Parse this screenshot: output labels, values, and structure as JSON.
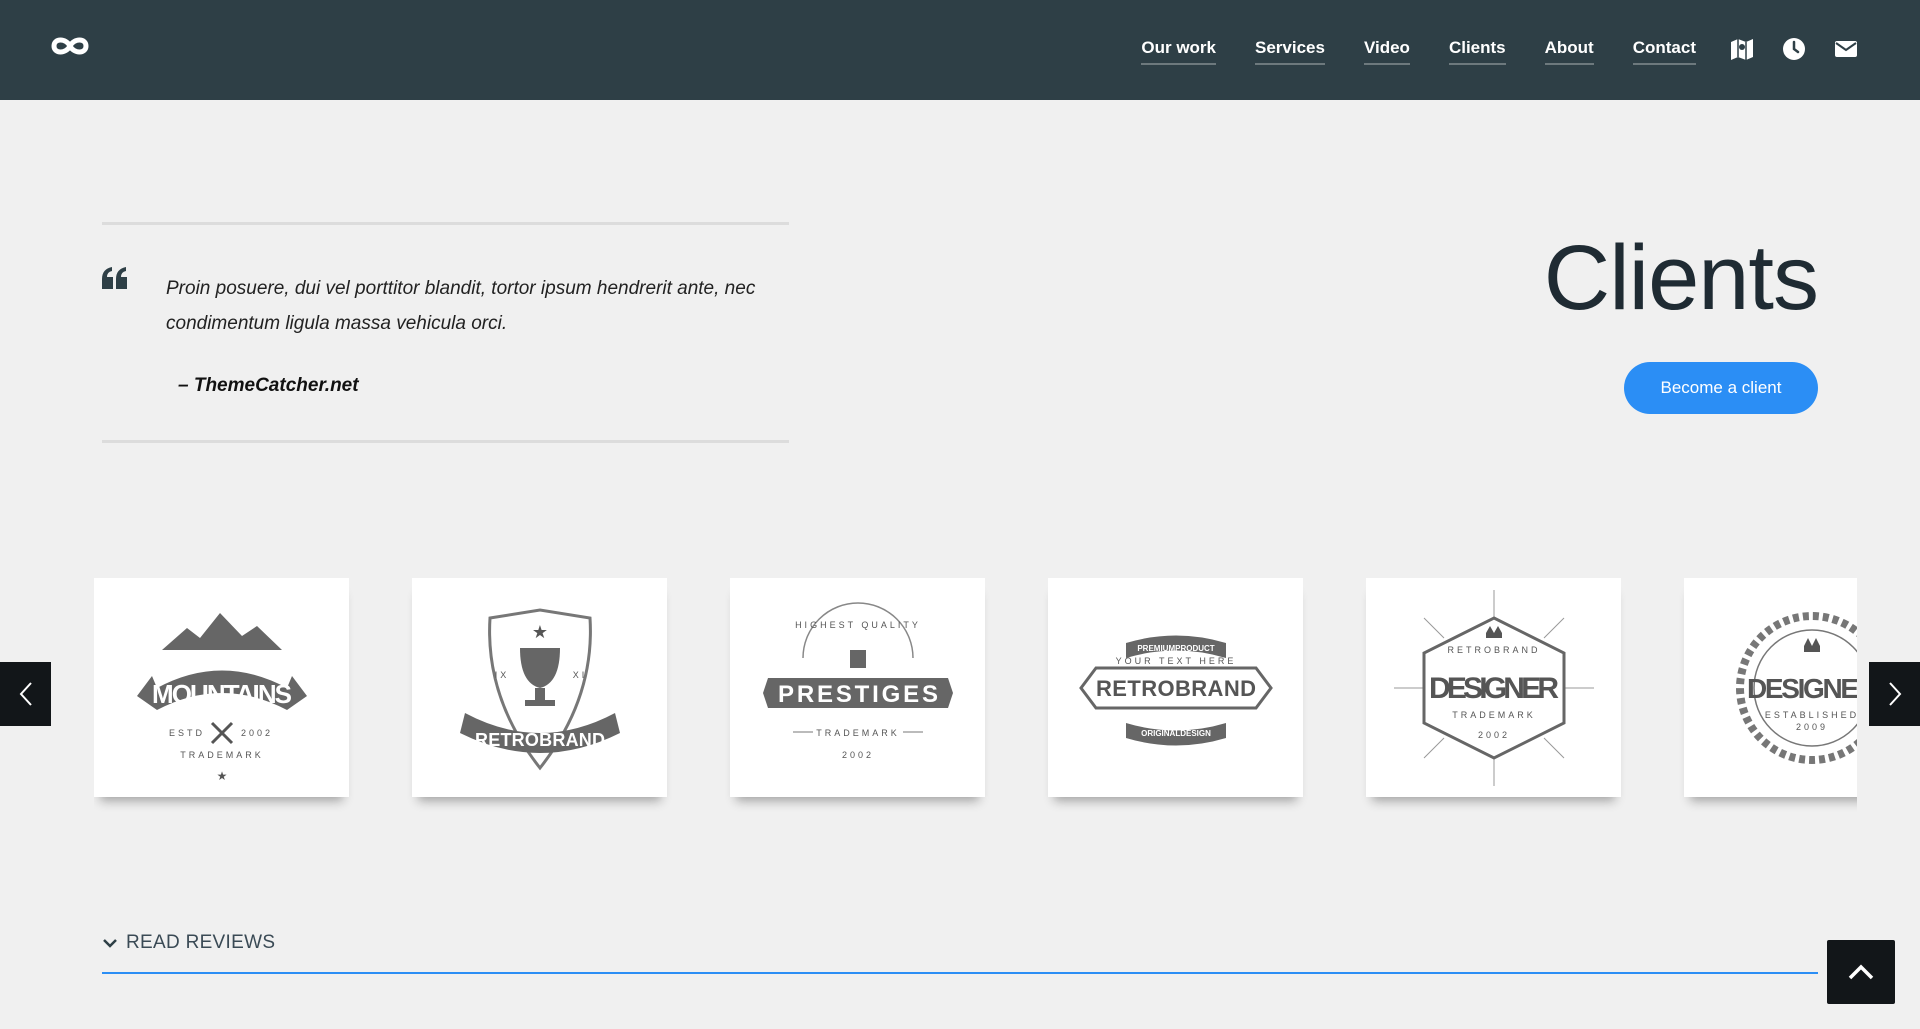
{
  "header": {
    "logo_icon": "infinity-logo-icon",
    "nav": [
      {
        "label": "Our work"
      },
      {
        "label": "Services"
      },
      {
        "label": "Video"
      },
      {
        "label": "Clients"
      },
      {
        "label": "About"
      },
      {
        "label": "Contact"
      }
    ],
    "icons": [
      "map-icon",
      "clock-icon",
      "mail-icon"
    ]
  },
  "quote": {
    "text": "Proin posuere, dui vel porttitor blandit, tortor ipsum hendrerit ante, nec condimentum ligula massa vehicula orci.",
    "author": "– ThemeCatcher.net"
  },
  "title": "Clients",
  "cta_label": "Become a client",
  "clients": [
    {
      "name": "MOUNTAINS",
      "sub": "TRADEMARK",
      "left": "ESTD",
      "right": "2002"
    },
    {
      "name": "RETROBRAND",
      "left": "IX",
      "right": "XI"
    },
    {
      "name": "PRESTIGES",
      "top": "HIGHEST QUALITY",
      "sub": "TRADEMARK",
      "year": "2002"
    },
    {
      "name": "RETROBRAND",
      "top": "PREMIUMPRODUCT",
      "small": "YOUR TEXT HERE",
      "bottom": "ORIGINALDESIGN"
    },
    {
      "name": "DESIGNER",
      "top": "RETROBRAND",
      "sub": "TRADEMARK",
      "year": "2002"
    },
    {
      "name": "DESIGNER",
      "sub": "ESTABLISHED",
      "year": "2009"
    }
  ],
  "reviews_label": "READ REVIEWS",
  "colors": {
    "header_bg": "#2e3f46",
    "accent": "#2b8ef5",
    "page_bg": "#f0f0f0",
    "logo_gray": "#6b6b6b"
  }
}
